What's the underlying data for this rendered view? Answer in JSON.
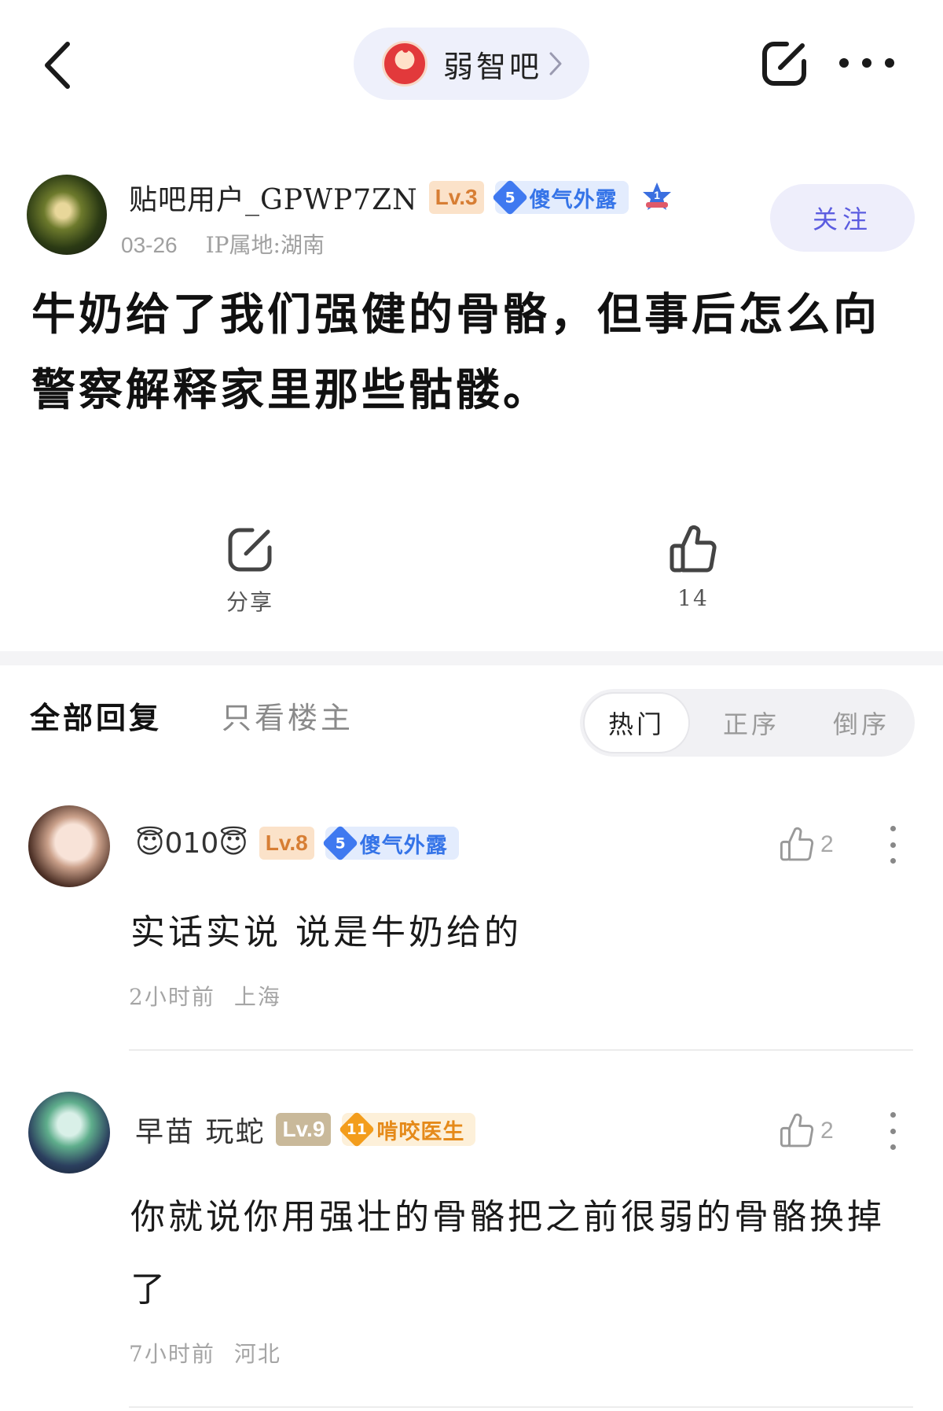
{
  "nav": {
    "forum_name": "弱智吧"
  },
  "post": {
    "author": {
      "name": "贴吧用户_GPWP7ZN",
      "level": "Lv.3",
      "title_level": "5",
      "title": "傻气外露",
      "rank": "1"
    },
    "date": "03-26",
    "ip_location": "IP属地:湖南",
    "follow_label": "关注",
    "text": "牛奶给了我们强健的骨骼，但事后怎么向警察解释家里那些骷髅。",
    "share_label": "分享",
    "like_count": "14"
  },
  "replies": {
    "tabs": {
      "all": "全部回复",
      "owner_only": "只看楼主"
    },
    "sort": {
      "hot": "热门",
      "asc": "正序",
      "desc": "倒序"
    },
    "items": [
      {
        "name": "😇010😇",
        "level": "Lv.8",
        "title_level": "5",
        "title": "傻气外露",
        "likes": "2",
        "text": "实话实说 说是牛奶给的",
        "time": "2小时前",
        "location": "上海"
      },
      {
        "name": "早苗 玩蛇",
        "level": "Lv.9",
        "title_level": "11",
        "title": "啃咬医生",
        "likes": "2",
        "text": "你就说你用强壮的骨骼把之前很弱的骨骼换掉了",
        "time": "7小时前",
        "location": "河北"
      }
    ]
  },
  "colors": {
    "accent": "#5b5ce0",
    "badge_blue": "#3f79f0",
    "badge_orange": "#f39d1c",
    "level_badge": "#d77e34"
  },
  "icons": [
    "back-icon",
    "chevron-right-icon",
    "edit-share-icon",
    "more-icon",
    "thumb-up-icon",
    "more-vertical-icon",
    "rank-icon"
  ]
}
